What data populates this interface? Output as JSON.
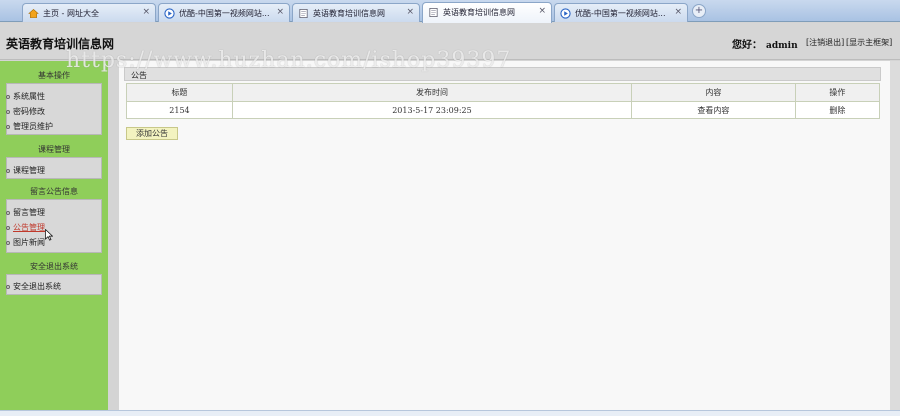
{
  "browser": {
    "tabs": [
      {
        "label": "主页 - 网址大全",
        "icon": "home-icon",
        "active": false
      },
      {
        "label": "优酷-中国第一视频网站...",
        "icon": "play-icon",
        "active": false
      },
      {
        "label": "英语教育培训信息网",
        "icon": "page-icon",
        "active": false
      },
      {
        "label": "英语教育培训信息网",
        "icon": "page-icon",
        "active": true
      },
      {
        "label": "优酷-中国第一视频网站...",
        "icon": "play-icon",
        "active": false
      }
    ],
    "close_glyph": "×",
    "new_tab_glyph": "+"
  },
  "header": {
    "site_title": "英语教育培训信息网",
    "greeting": "您好：",
    "username": "admin",
    "logout_link": "[注销退出]",
    "show_frame_link": "[显示主框架]"
  },
  "watermark": "https://www.huzhan.com/ishop39397",
  "sidebar": {
    "sections": [
      {
        "title": "基本操作",
        "items": [
          "系统属性",
          "密码修改",
          "管理员维护"
        ]
      },
      {
        "title": "课程管理",
        "items": [
          "课程管理"
        ]
      },
      {
        "title": "留言公告信息",
        "items": [
          "留言管理",
          "公告管理",
          "图片新闻"
        ]
      },
      {
        "title": "安全退出系统",
        "items": [
          "安全退出系统"
        ]
      }
    ],
    "active_item": "公告管理"
  },
  "main": {
    "panel_title": "公告",
    "table": {
      "headers": [
        "标题",
        "发布时间",
        "内容",
        "操作"
      ],
      "rows": [
        [
          "2154",
          "2013-5-17 23:09:25",
          "查看内容",
          "删除"
        ]
      ]
    },
    "add_button": "添加公告"
  },
  "colors": {
    "sidebar_bg": "#8fce5a",
    "header_bg": "#d6d6d6",
    "active_link": "#c0392b",
    "button_bg": "#f3f3c0"
  }
}
